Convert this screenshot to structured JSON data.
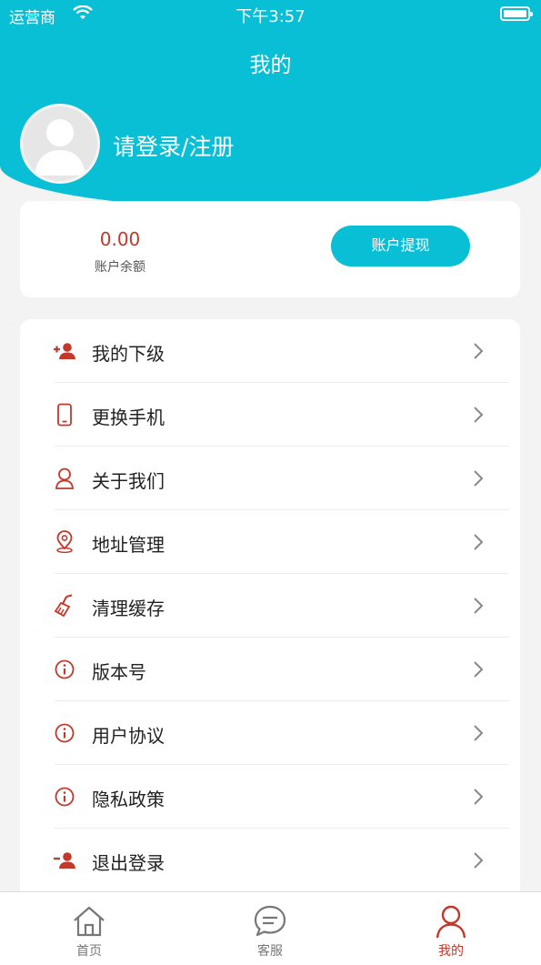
{
  "status_bar": {
    "carrier": "运营商",
    "time": "下午3:57"
  },
  "header": {
    "title": "我的",
    "login_text": "请登录/注册"
  },
  "balance": {
    "amount": "0.00",
    "label": "账户余额",
    "withdraw_label": "账户提现"
  },
  "menu": [
    {
      "label": "我的下级",
      "icon": "add-user-icon"
    },
    {
      "label": "更换手机",
      "icon": "phone-icon"
    },
    {
      "label": "关于我们",
      "icon": "user-outline-icon"
    },
    {
      "label": "地址管理",
      "icon": "location-pin-icon"
    },
    {
      "label": "清理缓存",
      "icon": "brush-icon"
    },
    {
      "label": "版本号",
      "icon": "info-icon"
    },
    {
      "label": "用户协议",
      "icon": "info-icon"
    },
    {
      "label": "隐私政策",
      "icon": "info-icon"
    },
    {
      "label": "退出登录",
      "icon": "remove-user-icon"
    }
  ],
  "tabs": [
    {
      "label": "首页",
      "icon": "home-icon",
      "active": false
    },
    {
      "label": "客服",
      "icon": "chat-icon",
      "active": false
    },
    {
      "label": "我的",
      "icon": "user-icon",
      "active": true
    }
  ],
  "colors": {
    "accent": "#08bfd6",
    "icon_red": "#c0392b",
    "background": "#f3f3f3"
  }
}
